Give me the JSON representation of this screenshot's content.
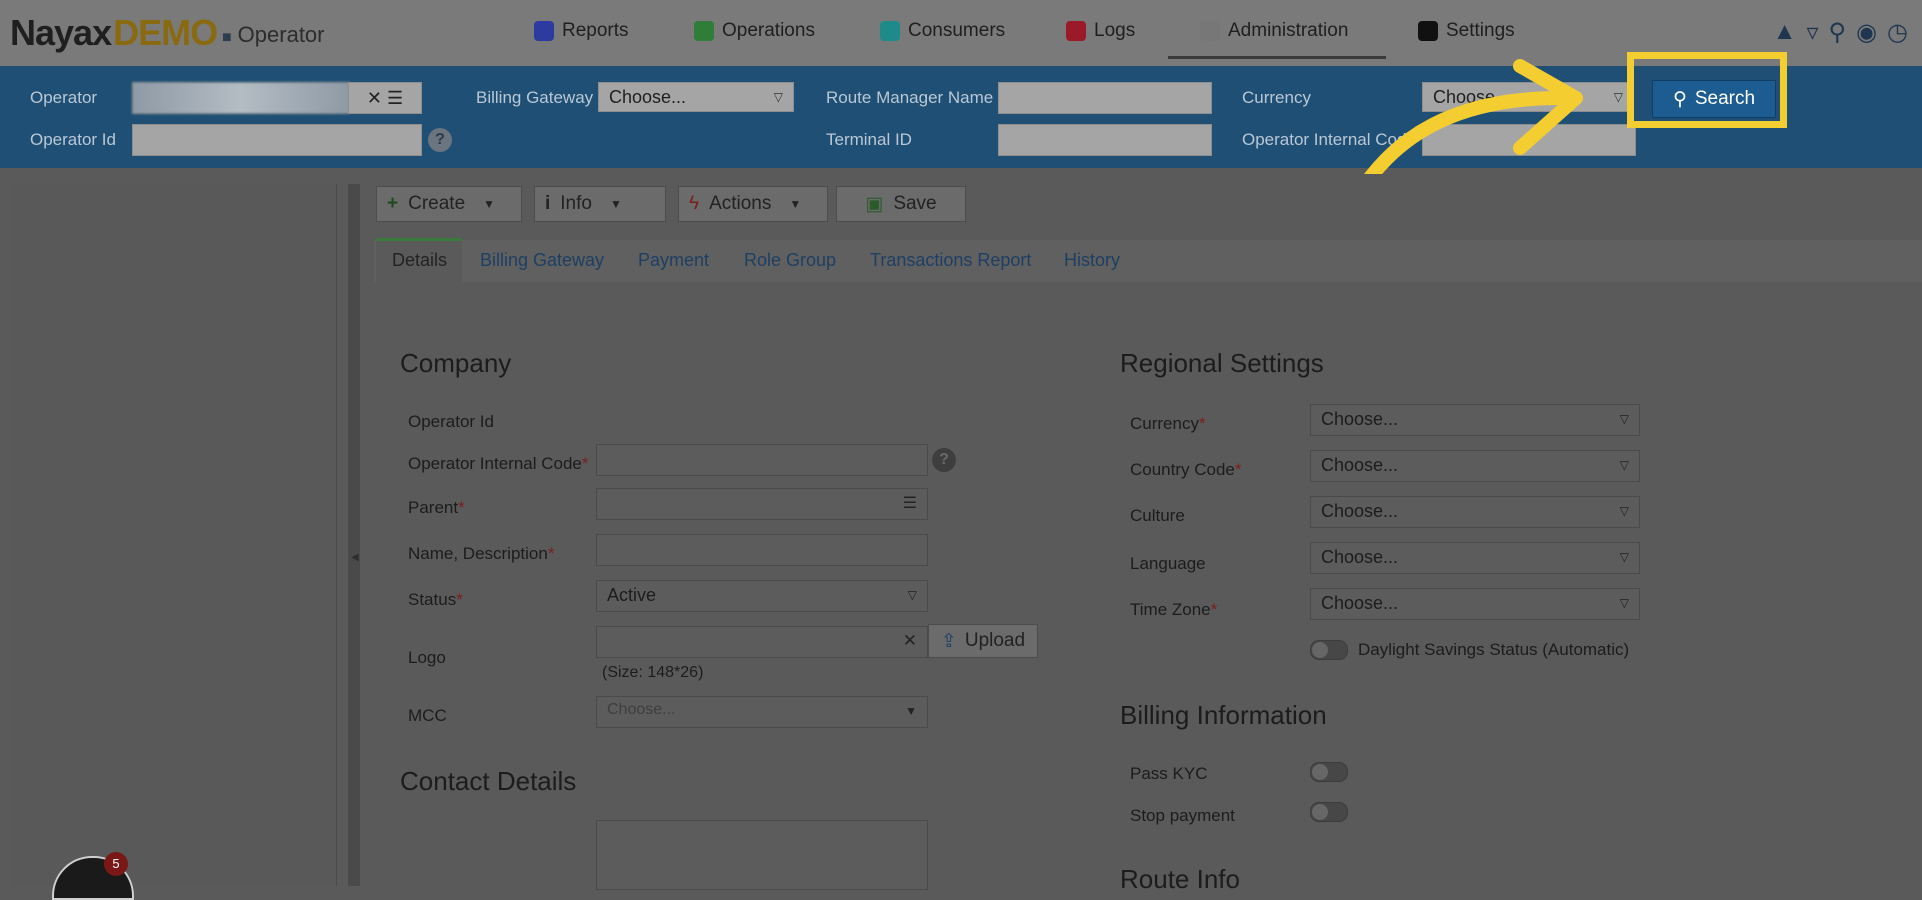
{
  "header": {
    "logo_main": "Nayax",
    "logo_demo": "DEMO",
    "operator_label": "Operator",
    "nav": [
      "Reports",
      "Operations",
      "Consumers",
      "Logs",
      "Administration",
      "Settings"
    ],
    "nav_icon_colors": [
      "#2d3aa0",
      "#2f7d38",
      "#1f8a8a",
      "#9a1a2a",
      "#777777",
      "#111111"
    ],
    "right_icons": [
      "graduation-cap-icon",
      "flask-icon",
      "search-icon",
      "globe-icon",
      "clock-icon"
    ]
  },
  "search_bar": {
    "operator_label": "Operator",
    "operator_id_label": "Operator Id",
    "billing_gateway_label": "Billing Gateway",
    "billing_gateway_value": "Choose...",
    "route_manager_label": "Route Manager Name",
    "terminal_id_label": "Terminal ID",
    "currency_label": "Currency",
    "currency_value": "Choose...",
    "operator_internal_code_label": "Operator Internal Code",
    "search_button": "Search"
  },
  "toolbar": {
    "create": "Create",
    "info": "Info",
    "actions": "Actions",
    "save": "Save"
  },
  "tabs": [
    "Details",
    "Billing Gateway",
    "Payment",
    "Role Group",
    "Transactions Report",
    "History"
  ],
  "company": {
    "title": "Company",
    "operator_id_label": "Operator Id",
    "internal_code_label": "Operator Internal Code",
    "parent_label": "Parent",
    "name_label": "Name, Description",
    "status_label": "Status",
    "status_value": "Active",
    "logo_label": "Logo",
    "logo_size_hint": "(Size: 148*26)",
    "upload_button": "Upload",
    "mcc_label": "MCC",
    "mcc_placeholder": "Choose...",
    "required_mark": "*"
  },
  "contact": {
    "title": "Contact Details"
  },
  "regional": {
    "title": "Regional Settings",
    "currency_label": "Currency",
    "country_label": "Country Code",
    "culture_label": "Culture",
    "language_label": "Language",
    "timezone_label": "Time Zone",
    "choose": "Choose...",
    "daylight_label": "Daylight Savings Status (Automatic)"
  },
  "billing": {
    "title": "Billing Information",
    "pass_kyc_label": "Pass KYC",
    "stop_payment_label": "Stop payment"
  },
  "route_info": {
    "title": "Route Info"
  },
  "notification_count": "5",
  "accent_colors": {
    "highlight": "#f4cd30",
    "search_button": "#1d5c91",
    "search_bar": "#1f4f74"
  }
}
